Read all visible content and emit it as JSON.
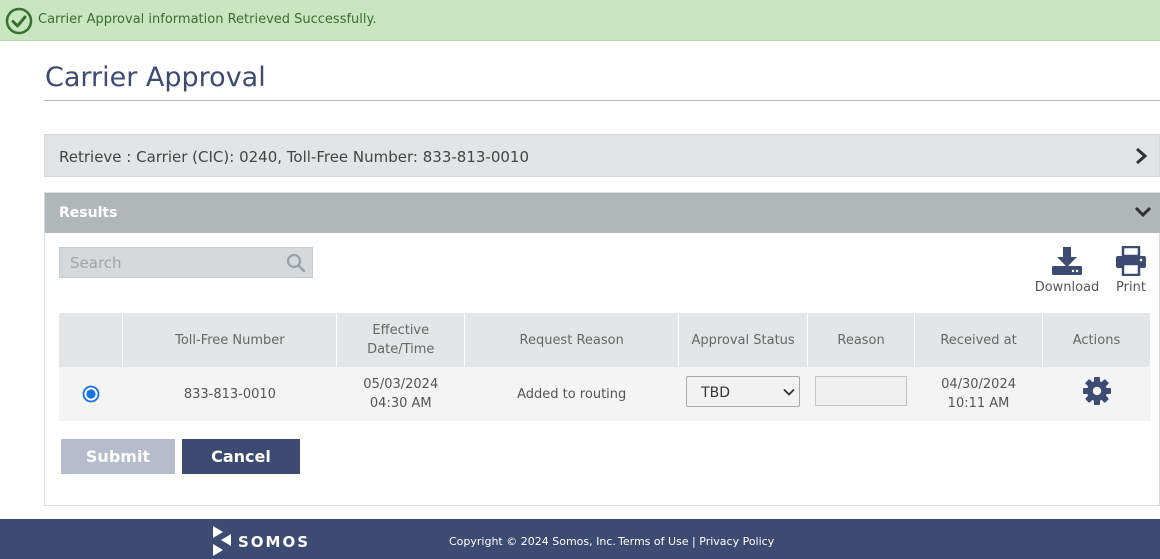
{
  "banner": {
    "message": "Carrier Approval information Retrieved Successfully."
  },
  "page": {
    "title": "Carrier Approval"
  },
  "retrieve": {
    "label": "Retrieve : Carrier (CIC): 0240, Toll-Free Number: 833-813-0010"
  },
  "results": {
    "label": "Results",
    "search_placeholder": "Search",
    "download_label": "Download",
    "print_label": "Print",
    "columns": [
      "",
      "Toll-Free Number",
      "Effective Date/Time",
      "Request Reason",
      "Approval Status",
      "Reason",
      "Received at",
      "Actions"
    ],
    "columns_split": {
      "effective_1": "Effective",
      "effective_2": "Date/Time"
    },
    "rows": [
      {
        "selected": true,
        "toll_free_number": "833-813-0010",
        "effective_date": "05/03/2024",
        "effective_time": "04:30 AM",
        "request_reason": "Added to routing",
        "approval_status": "TBD",
        "reason": "",
        "received_date": "04/30/2024",
        "received_time": "10:11 AM"
      }
    ],
    "submit_label": "Submit",
    "cancel_label": "Cancel"
  },
  "footer": {
    "brand": "SOMOS",
    "copyright": "Copyright © 2024 Somos, Inc.",
    "terms": "Terms of Use",
    "separator": "|",
    "privacy": "Privacy Policy"
  },
  "colors": {
    "primary": "#3d4a72",
    "success_bg": "#c8e6c0",
    "success_text": "#3d6b33",
    "radio": "#1a73e8"
  }
}
